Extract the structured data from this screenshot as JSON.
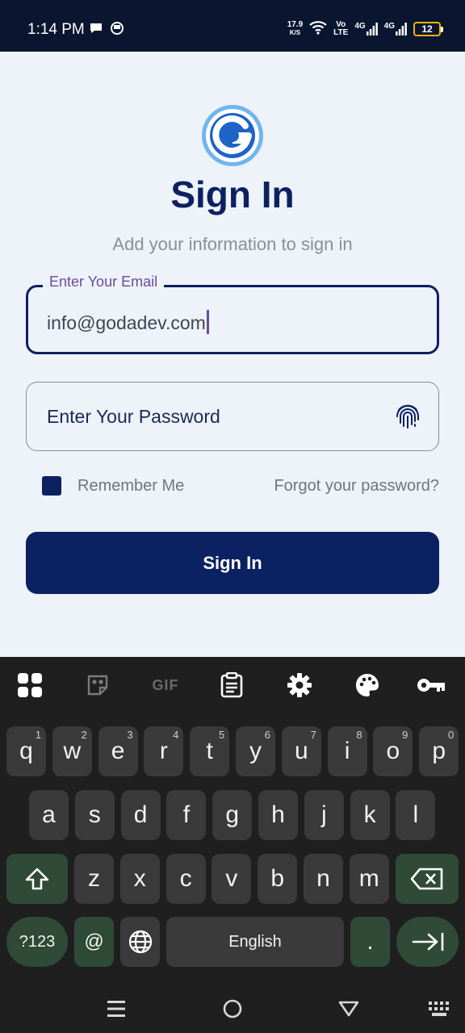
{
  "status_bar": {
    "time": "1:14 PM",
    "net_speed_value": "17.9",
    "net_speed_unit": "K/S",
    "volte_top": "Vo",
    "volte_bottom": "LTE",
    "sig1": "4G",
    "sig2": "4G",
    "battery": "12"
  },
  "header": {
    "title": "Sign In",
    "subtitle": "Add your information to sign in"
  },
  "form": {
    "email_label": "Enter Your Email",
    "email_value": "info@godadev.com",
    "password_placeholder": "Enter Your Password",
    "remember_label": "Remember Me",
    "remember_checked": true,
    "forgot_link": "Forgot your password?",
    "submit_label": "Sign In"
  },
  "keyboard": {
    "toolbar_gif": "GIF",
    "row1": [
      {
        "key": "q",
        "hint": "1"
      },
      {
        "key": "w",
        "hint": "2"
      },
      {
        "key": "e",
        "hint": "3"
      },
      {
        "key": "r",
        "hint": "4"
      },
      {
        "key": "t",
        "hint": "5"
      },
      {
        "key": "y",
        "hint": "6"
      },
      {
        "key": "u",
        "hint": "7"
      },
      {
        "key": "i",
        "hint": "8"
      },
      {
        "key": "o",
        "hint": "9"
      },
      {
        "key": "p",
        "hint": "0"
      }
    ],
    "row2": [
      "a",
      "s",
      "d",
      "f",
      "g",
      "h",
      "j",
      "k",
      "l"
    ],
    "row3": [
      "z",
      "x",
      "c",
      "v",
      "b",
      "n",
      "m"
    ],
    "sym_label": "?123",
    "at_label": "@",
    "space_label": "English",
    "period_label": "."
  },
  "colors": {
    "primary": "#0c2161",
    "background": "#eef2f9",
    "label_purple": "#6a4c9c",
    "keyboard_bg": "#1f1f1f",
    "key_bg": "#3a3a3a",
    "key_green": "#2f4a36"
  }
}
